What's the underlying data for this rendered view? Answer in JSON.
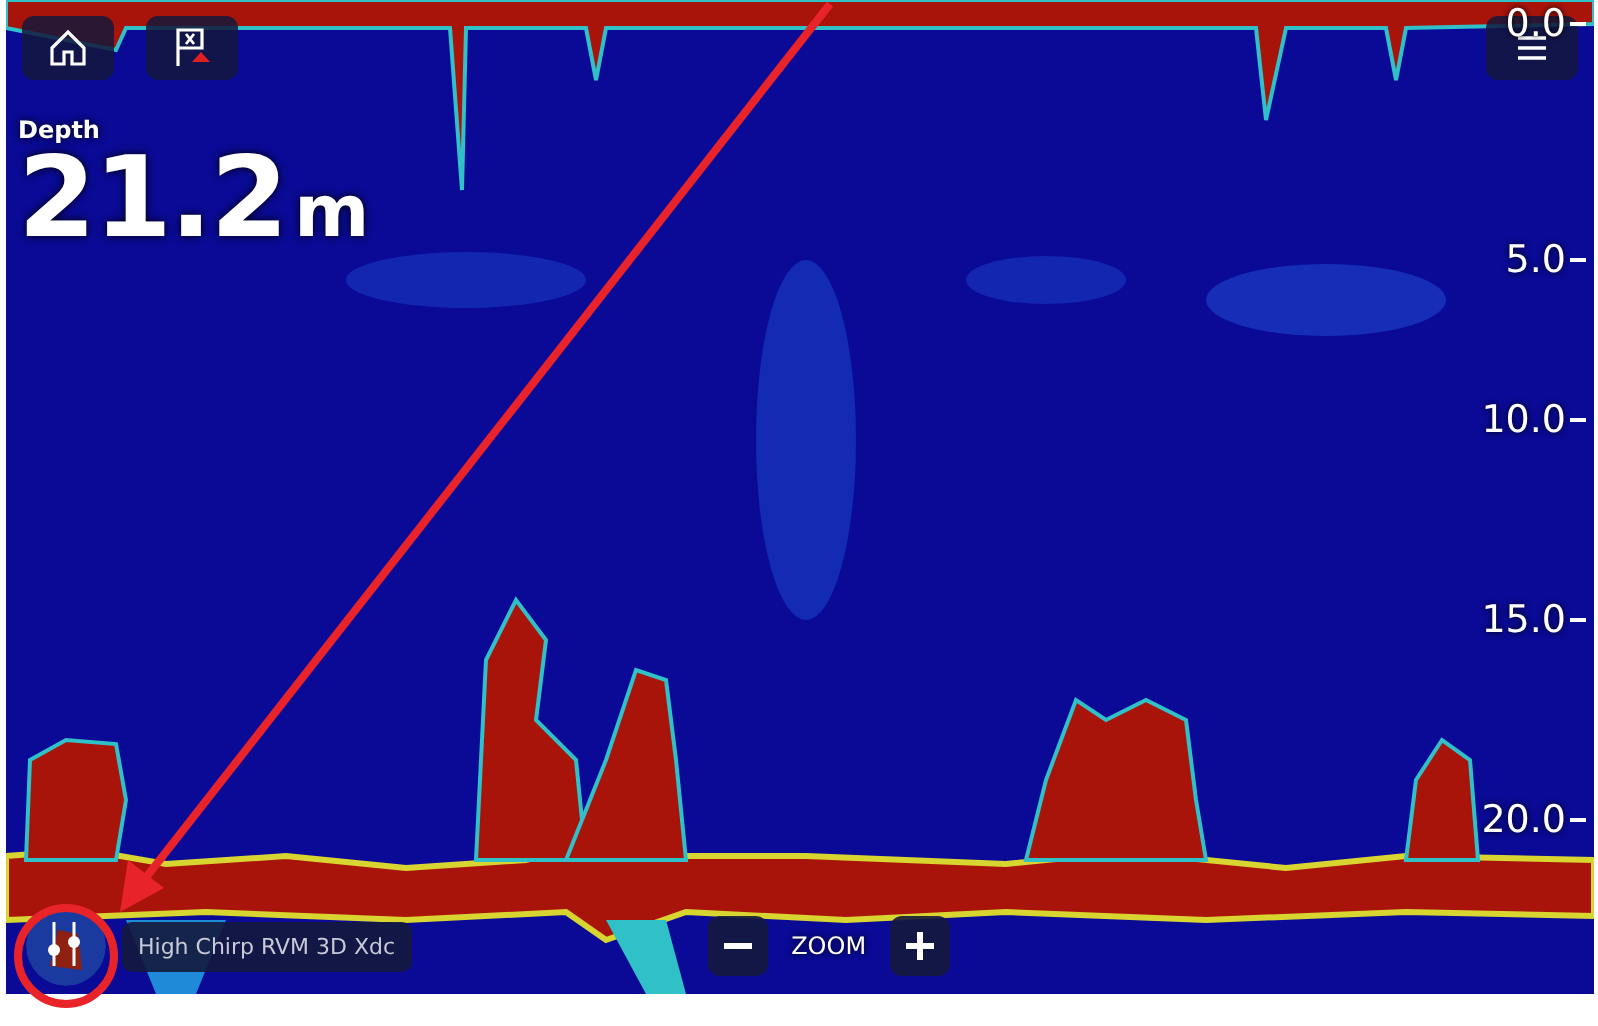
{
  "depth": {
    "label": "Depth",
    "value": "21.2",
    "unit": "m"
  },
  "scale": [
    "0.0",
    "5.0",
    "10.0",
    "15.0",
    "20.0"
  ],
  "transducer": {
    "name": "High Chirp RVM 3D Xdc"
  },
  "zoom": {
    "label": "ZOOM"
  }
}
